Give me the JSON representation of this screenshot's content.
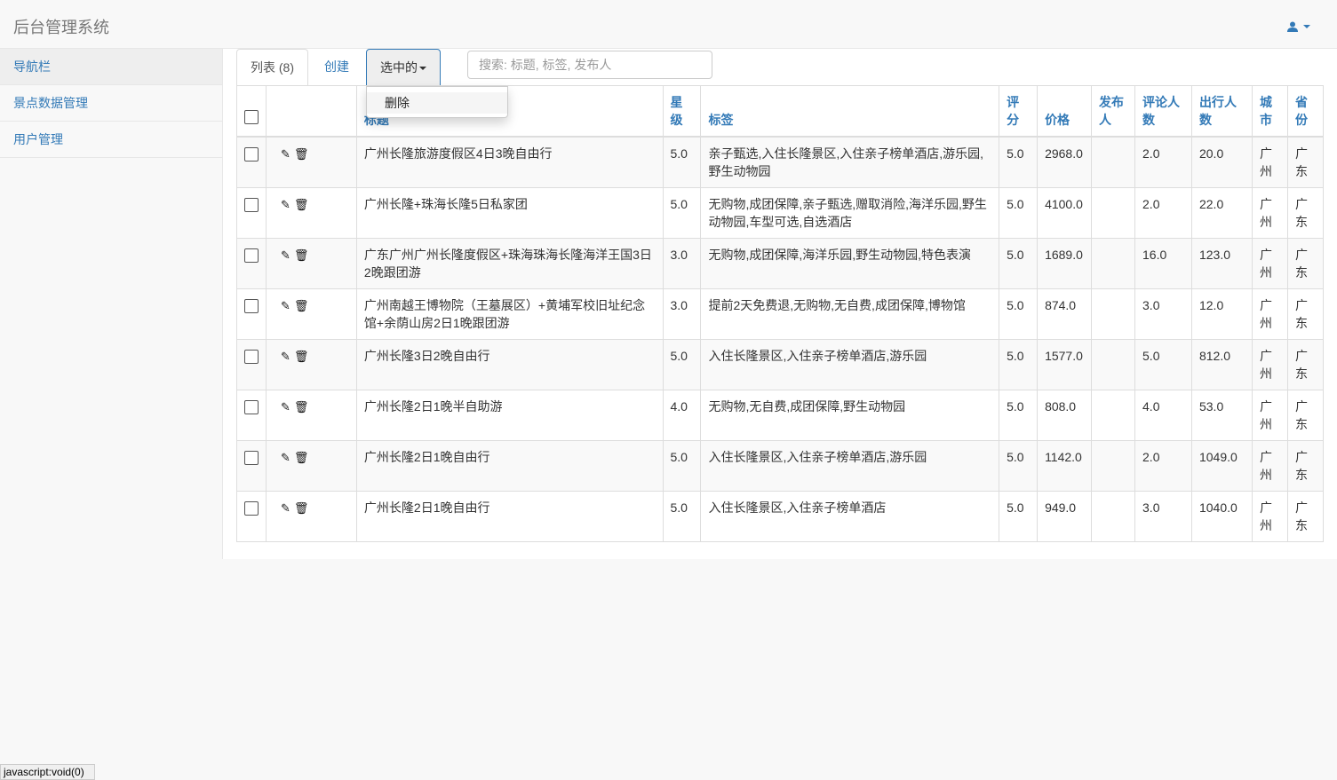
{
  "app_title": "后台管理系统",
  "sidebar": {
    "items": [
      "导航栏",
      "景点数据管理",
      "用户管理"
    ]
  },
  "tabs": {
    "list": "列表 (8)",
    "create": "创建",
    "selected": "选中的"
  },
  "search": {
    "placeholder": "搜索: 标题, 标签, 发布人"
  },
  "dropdown": {
    "delete": "删除"
  },
  "table": {
    "headers": [
      "标题",
      "星级",
      "标签",
      "评分",
      "价格",
      "发布人",
      "评论人数",
      "出行人数",
      "城市",
      "省份"
    ],
    "rows": [
      [
        "广州长隆旅游度假区4日3晚自由行",
        "5.0",
        "亲子甄选,入住长隆景区,入住亲子榜单酒店,游乐园,野生动物园",
        "5.0",
        "2968.0",
        "",
        "2.0",
        "20.0",
        "广州",
        "广东"
      ],
      [
        "广州长隆+珠海长隆5日私家团",
        "5.0",
        "无购物,成团保障,亲子甄选,赠取消险,海洋乐园,野生动物园,车型可选,自选酒店",
        "5.0",
        "4100.0",
        "",
        "2.0",
        "22.0",
        "广州",
        "广东"
      ],
      [
        "广东广州广州长隆度假区+珠海珠海长隆海洋王国3日2晚跟团游",
        "3.0",
        "无购物,成团保障,海洋乐园,野生动物园,特色表演",
        "5.0",
        "1689.0",
        "",
        "16.0",
        "123.0",
        "广州",
        "广东"
      ],
      [
        "广州南越王博物院（王墓展区）+黄埔军校旧址纪念馆+余荫山房2日1晚跟团游",
        "3.0",
        "提前2天免费退,无购物,无自费,成团保障,博物馆",
        "5.0",
        "874.0",
        "",
        "3.0",
        "12.0",
        "广州",
        "广东"
      ],
      [
        "广州长隆3日2晚自由行",
        "5.0",
        "入住长隆景区,入住亲子榜单酒店,游乐园",
        "5.0",
        "1577.0",
        "",
        "5.0",
        "812.0",
        "广州",
        "广东"
      ],
      [
        "广州长隆2日1晚半自助游",
        "4.0",
        "无购物,无自费,成团保障,野生动物园",
        "5.0",
        "808.0",
        "",
        "4.0",
        "53.0",
        "广州",
        "广东"
      ],
      [
        "广州长隆2日1晚自由行",
        "5.0",
        "入住长隆景区,入住亲子榜单酒店,游乐园",
        "5.0",
        "1142.0",
        "",
        "2.0",
        "1049.0",
        "广州",
        "广东"
      ],
      [
        "广州长隆2日1晚自由行",
        "5.0",
        "入住长隆景区,入住亲子榜单酒店",
        "5.0",
        "949.0",
        "",
        "3.0",
        "1040.0",
        "广州",
        "广东"
      ]
    ]
  },
  "status_bar": "javascript:void(0)",
  "icons": {
    "edit": "pencil-icon",
    "delete": "trash-icon",
    "user": "user-icon"
  }
}
